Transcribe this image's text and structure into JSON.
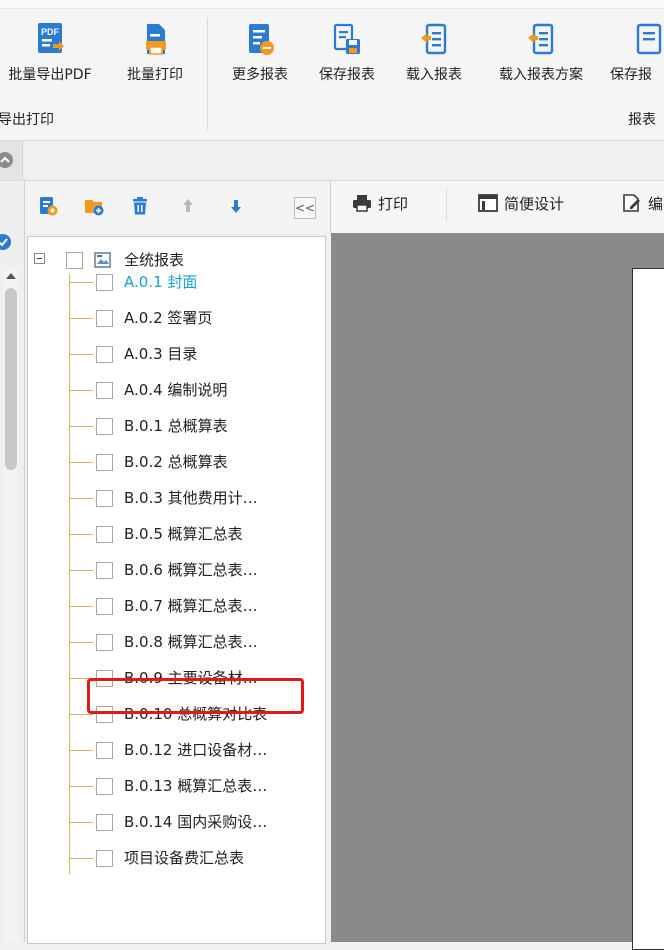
{
  "ribbon": {
    "buttons": [
      {
        "label": "批量导出PDF",
        "icon": "pdf-export-icon"
      },
      {
        "label": "批量打印",
        "icon": "print-batch-icon"
      },
      {
        "label": "更多报表",
        "icon": "more-reports-icon"
      },
      {
        "label": "保存报表",
        "icon": "save-report-icon"
      },
      {
        "label": "载入报表",
        "icon": "load-report-icon"
      },
      {
        "label": "载入报表方案",
        "icon": "load-scheme-icon"
      },
      {
        "label": "保存报",
        "icon": "save-scheme-icon"
      }
    ],
    "groups": [
      "导出打印",
      "报表"
    ]
  },
  "tree_toolbar": {
    "icons": [
      "add-report-icon",
      "add-folder-icon",
      "delete-icon",
      "move-up-icon",
      "move-down-icon",
      "collapse-icon"
    ],
    "collapse_label": "<<"
  },
  "tree": {
    "root": "全统报表",
    "items": [
      {
        "label": "A.0.1 封面",
        "selected": true
      },
      {
        "label": "A.0.2 签署页"
      },
      {
        "label": "A.0.3 目录"
      },
      {
        "label": "A.0.4 编制说明"
      },
      {
        "label": "B.0.1 总概算表"
      },
      {
        "label": "B.0.2 总概算表"
      },
      {
        "label": "B.0.3 其他费用计…"
      },
      {
        "label": "B.0.5 概算汇总表"
      },
      {
        "label": "B.0.6 概算汇总表…"
      },
      {
        "label": "B.0.7 概算汇总表…"
      },
      {
        "label": "B.0.8 概算汇总表…"
      },
      {
        "label": "B.0.9 主要设备材…",
        "highlighted": true
      },
      {
        "label": "B.0.10 总概算对比表"
      },
      {
        "label": "B.0.12 进口设备材…"
      },
      {
        "label": "B.0.13 概算汇总表…"
      },
      {
        "label": "B.0.14 国内采购设…"
      },
      {
        "label": "项目设备费汇总表"
      }
    ]
  },
  "preview_toolbar": {
    "print_label": "打印",
    "design_label": "简便设计",
    "edit_label": "编"
  },
  "colors": {
    "selected_text": "#1aa0d9",
    "highlight_border": "#e01919",
    "tree_line": "#e3b25c",
    "icon_blue": "#2b7bd3",
    "icon_orange": "#f39a1e"
  }
}
